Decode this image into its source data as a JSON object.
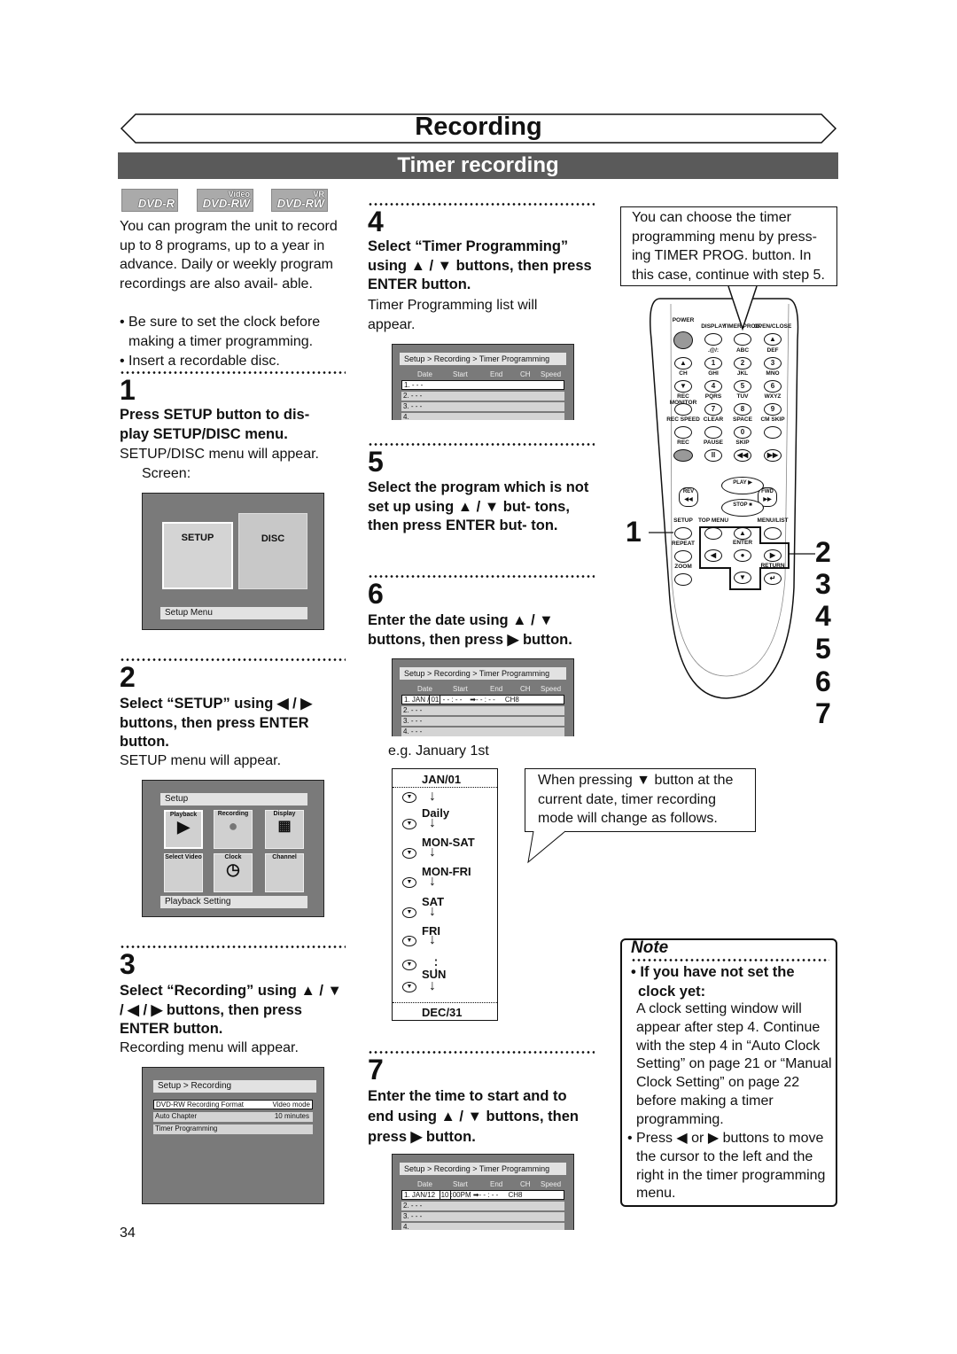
{
  "header": {
    "title": "Recording",
    "subtitle": "Timer recording"
  },
  "logos": [
    {
      "main": "DVD-R",
      "sup": ""
    },
    {
      "main": "DVD-RW",
      "sup": "Video"
    },
    {
      "main": "DVD-RW",
      "sup": "VR"
    }
  ],
  "intro": {
    "text": "You can program the unit to record up to 8 programs, up to a year in advance. Daily or weekly program recordings are also avail- able.",
    "bullets": [
      "• Be sure to set the clock before making a timer programming.",
      "• Insert a recordable disc."
    ]
  },
  "steps": [
    {
      "num": "1",
      "instruction": "Press SETUP button to dis- play SETUP/DISC menu.",
      "result": "SETUP/DISC menu will appear.",
      "extra": "Screen:"
    },
    {
      "num": "2",
      "instruction": "Select “SETUP” using ◀ / ▶ buttons, then press ENTER button.",
      "result": "SETUP menu will appear."
    },
    {
      "num": "3",
      "instruction": "Select “Recording” using ▲ / ▼ / ◀ / ▶ buttons, then press ENTER button.",
      "result": "Recording menu will appear."
    },
    {
      "num": "4",
      "instruction": "Select “Timer Programming” using ▲ / ▼ buttons, then press ENTER button.",
      "result": "Timer Programming list will appear."
    },
    {
      "num": "5",
      "instruction": "Select the program which is not set up using ▲ / ▼ but- tons, then press ENTER but- ton."
    },
    {
      "num": "6",
      "instruction": "Enter the date using ▲ / ▼ buttons, then press ▶ button.",
      "result": "e.g. January 1st"
    },
    {
      "num": "7",
      "instruction": "Enter the time to start and to end using ▲ / ▼ buttons, then press ▶ button."
    }
  ],
  "screen1": {
    "setup": "SETUP",
    "disc": "DISC",
    "footer": "Setup Menu"
  },
  "screen2": {
    "title": "Setup",
    "tiles": [
      "Playback",
      "Recording",
      "Display",
      "Select Video",
      "Clock",
      "Channel"
    ],
    "footer": "Playback Setting"
  },
  "screen3": {
    "title": "Setup > Recording",
    "rows": [
      {
        "label": "DVD-RW Recording Format",
        "value": "Video mode"
      },
      {
        "label": "Auto Chapter",
        "value": "10 minutes"
      },
      {
        "label": "Timer Programming",
        "value": ""
      }
    ]
  },
  "timer_screen": {
    "title": "Setup > Recording > Timer Programming",
    "columns": [
      "Date",
      "Start",
      "End",
      "CH",
      "Speed"
    ],
    "s4_rows": [
      "1. - - -",
      "2. - - -",
      "3. - - -",
      "4."
    ],
    "s6_rows": [
      "1. JAN /",
      "01",
      "- - : - -",
      "➡- - : - -",
      "CH8",
      "2. - - -",
      "3. - - -",
      "4. - - -"
    ],
    "s7_rows": [
      "1. JAN/12",
      "10",
      ":00PM ➡- - : - -",
      "CH8",
      "2. - - -",
      "3. - - -",
      "4."
    ]
  },
  "callout_top": "You can choose the timer programming menu by press- ing TIMER PROG. button. In this case, continue with step 5.",
  "callout_mode": "When pressing ▼ button at the current date, timer recording mode will change as follows.",
  "mode_cycle": [
    "JAN/01",
    "Daily",
    "MON-SAT",
    "MON-FRI",
    "SAT",
    "FRI",
    "SUN",
    "DEC/31"
  ],
  "remote": {
    "buttons": [
      [
        "POWER",
        ""
      ],
      [
        "DISPLAY",
        ""
      ],
      [
        "TIMER PROG.",
        ""
      ],
      [
        "OPEN/CLOSE",
        "▲"
      ],
      [
        "",
        "▲"
      ],
      [
        ".@/:",
        "1"
      ],
      [
        "ABC",
        "2"
      ],
      [
        "DEF",
        "3"
      ],
      [
        "CH",
        "▼"
      ],
      [
        "GHI",
        "4"
      ],
      [
        "JKL",
        "5"
      ],
      [
        "MNO",
        "6"
      ],
      [
        "REC MONITOR",
        ""
      ],
      [
        "PQRS",
        "7"
      ],
      [
        "TUV",
        "8"
      ],
      [
        "WXYZ",
        "9"
      ],
      [
        "REC SPEED",
        ""
      ],
      [
        "CLEAR",
        ""
      ],
      [
        "SPACE",
        "0"
      ],
      [
        "CM SKIP",
        ""
      ],
      [
        "REC",
        ""
      ],
      [
        "PAUSE",
        "II"
      ],
      [
        "SKIP",
        "◀◀"
      ],
      [
        "",
        "▶▶"
      ],
      [
        "PLAY ▶",
        ""
      ],
      [
        "REV ◀◀",
        ""
      ],
      [
        "FWD ▶▶",
        ""
      ],
      [
        "STOP ■",
        ""
      ],
      [
        "SETUP",
        ""
      ],
      [
        "TOP MENU",
        ""
      ],
      [
        "MENU/LIST",
        ""
      ],
      [
        "",
        "▲"
      ],
      [
        "ENTER",
        "●"
      ],
      [
        "",
        "◀"
      ],
      [
        "",
        "▶"
      ],
      [
        "",
        "▼"
      ],
      [
        "REPEAT",
        ""
      ],
      [
        "ZOOM",
        ""
      ],
      [
        "RETURN",
        "↵"
      ]
    ],
    "step_labels": [
      "1",
      "2",
      "3",
      "4",
      "5",
      "6",
      "7"
    ]
  },
  "note": {
    "title": "Note",
    "items": [
      {
        "head": "• If you have not set the clock yet:",
        "body": "A clock setting window will appear after step 4. Continue with the step 4 in “Auto Clock Setting” on page 21 or “Manual Clock Setting” on page 22 before making a timer programming."
      },
      {
        "head": "",
        "body": "• Press ◀ or ▶ buttons to move the cursor to the left and the right in the timer programming menu."
      }
    ]
  },
  "page_number": "34"
}
